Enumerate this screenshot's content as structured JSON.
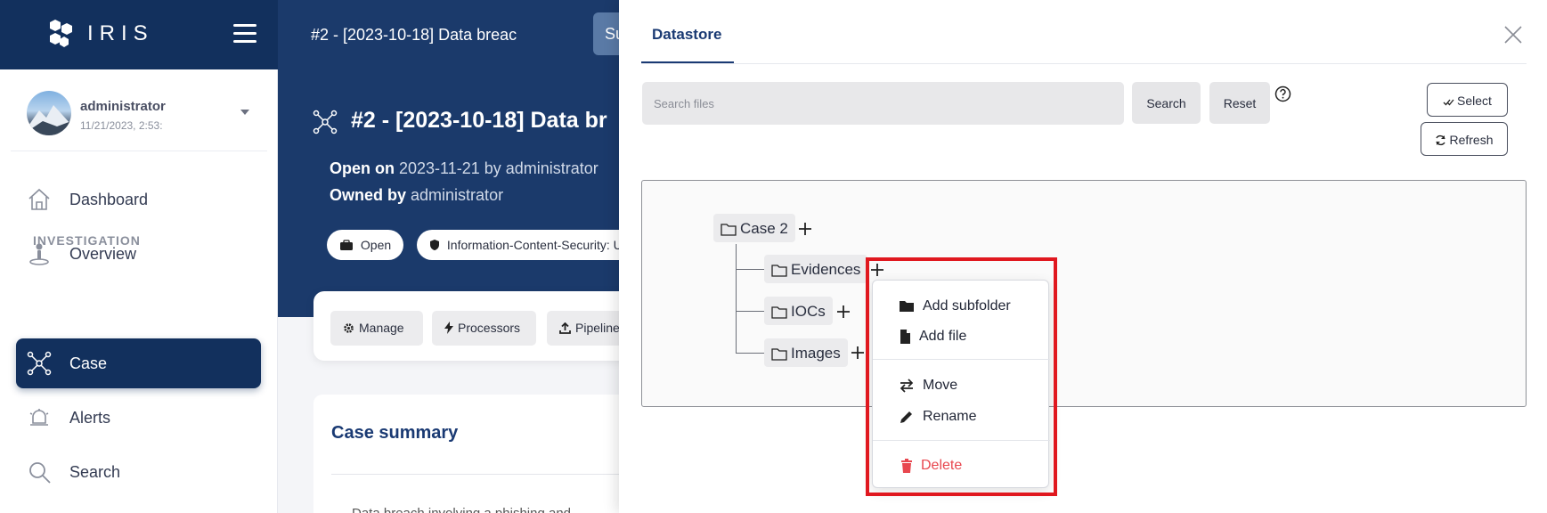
{
  "app": {
    "logo_text": "IRIS",
    "top_case_title": "#2 - [2023-10-18] Data breac",
    "top_pill_text": "Su"
  },
  "user": {
    "name": "administrator",
    "timestamp": "11/21/2023, 2:53:"
  },
  "nav": {
    "items": [
      {
        "label": "Dashboard",
        "icon": "home-icon"
      },
      {
        "label": "Overview",
        "icon": "overview-icon"
      }
    ],
    "section_label": "INVESTIGATION",
    "items2": [
      {
        "label": "Case",
        "icon": "case-network-icon",
        "active": true
      },
      {
        "label": "Alerts",
        "icon": "alerts-icon"
      },
      {
        "label": "Search",
        "icon": "search-icon"
      }
    ]
  },
  "case": {
    "title": "#2 - [2023-10-18] Data br",
    "open_on_label": "Open on",
    "open_on_value": "2023-11-21 by administrator",
    "owned_by_label": "Owned by",
    "owned_by_value": "administrator",
    "status_pill": "Open",
    "classification_pill": "Information-Content-Security: U",
    "toolbar": {
      "manage": "Manage",
      "processors": "Processors",
      "pipelines": "Pipeline"
    },
    "summary_title": "Case summary",
    "summary_snippet": "Data breach involving a phishing and"
  },
  "datastore": {
    "tab_label": "Datastore",
    "search_placeholder": "Search files",
    "search_button": "Search",
    "reset_button": "Reset",
    "select_button": "Select",
    "refresh_button": "Refresh",
    "tree": {
      "root": "Case 2",
      "children": [
        "Evidences",
        "IOCs",
        "Images"
      ]
    },
    "context_menu": {
      "add_subfolder": "Add subfolder",
      "add_file": "Add file",
      "move": "Move",
      "rename": "Rename",
      "delete": "Delete"
    }
  },
  "colors": {
    "brand_dark": "#12305d",
    "header": "#1b3a6b",
    "danger": "#e8474f",
    "highlight": "#e0181f"
  }
}
